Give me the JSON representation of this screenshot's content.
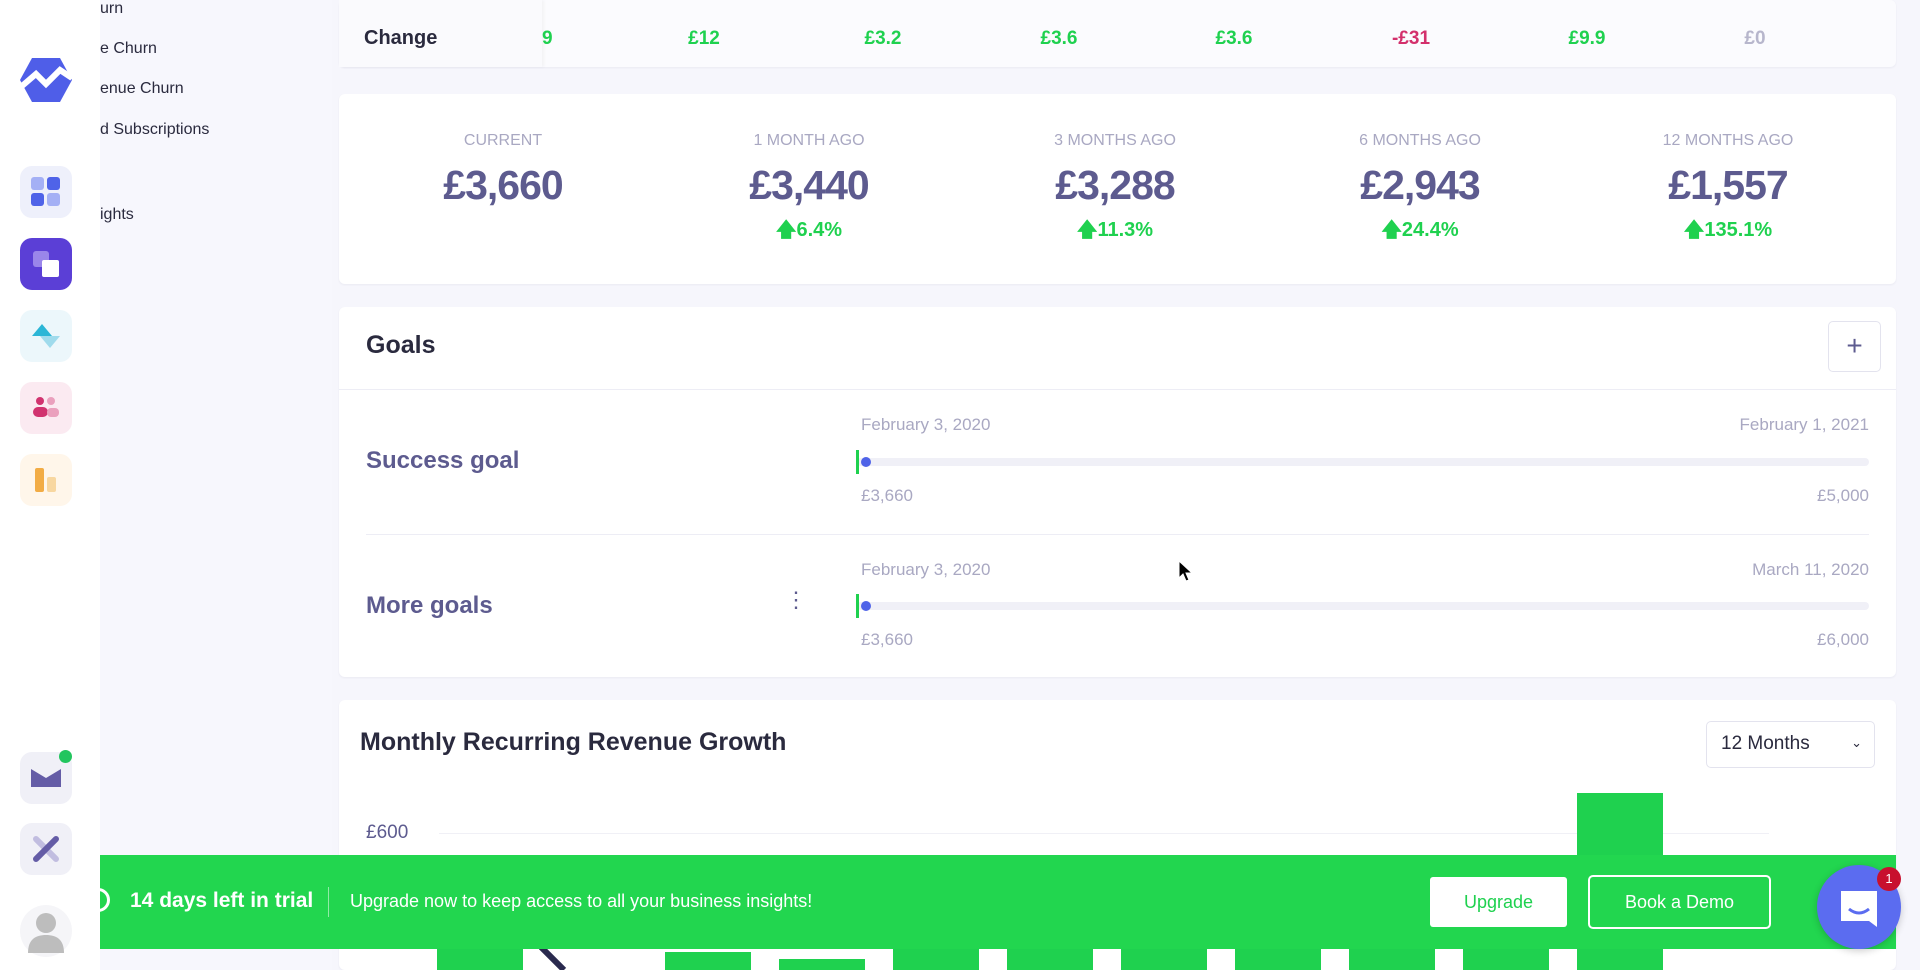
{
  "sidebar": {
    "icons": [
      "logo-icon",
      "dashboard-icon",
      "layers-icon",
      "insights-icon",
      "customers-icon",
      "reports-icon",
      "mail-icon",
      "tools-icon",
      "avatar-icon"
    ],
    "mail_badge_color": "#22c55e"
  },
  "submenu": {
    "items": [
      "urn",
      "e Churn",
      "enue Churn",
      "d Subscriptions",
      "ights"
    ]
  },
  "change_row": {
    "label": "Change",
    "values": [
      "9",
      "£12",
      "£3.2",
      "£3.6",
      "£3.6",
      "-£31",
      "£9.9",
      "£0"
    ]
  },
  "stats": [
    {
      "label": "CURRENT",
      "value": "£3,660",
      "change": ""
    },
    {
      "label": "1 MONTH AGO",
      "value": "£3,440",
      "change": "6.4%"
    },
    {
      "label": "3 MONTHS AGO",
      "value": "£3,288",
      "change": "11.3%"
    },
    {
      "label": "6 MONTHS AGO",
      "value": "£2,943",
      "change": "24.4%"
    },
    {
      "label": "12 MONTHS AGO",
      "value": "£1,557",
      "change": "135.1%"
    }
  ],
  "goals": {
    "title": "Goals",
    "add_label": "+",
    "items": [
      {
        "name": "Success goal",
        "start_date": "February 3, 2020",
        "end_date": "February 1, 2021",
        "current": "£3,660",
        "target": "£5,000",
        "progress": 0.01
      },
      {
        "name": "More goals",
        "start_date": "February 3, 2020",
        "end_date": "March 11, 2020",
        "current": "£3,660",
        "target": "£6,000",
        "progress": 0.01
      }
    ]
  },
  "mrr": {
    "title": "Monthly Recurring Revenue Growth",
    "range": "12 Months"
  },
  "chart_data": {
    "type": "bar",
    "y_tick_labels": [
      "£600"
    ],
    "values": [
      390,
      0,
      375,
      362,
      390,
      390,
      390,
      390,
      390,
      390,
      676
    ],
    "color": "#1fd14f"
  },
  "banner": {
    "trial": "14 days left in trial",
    "message": "Upgrade now to keep access to all your business insights!",
    "upgrade": "Upgrade",
    "demo": "Book a Demo",
    "color": "#22d64f"
  },
  "chat": {
    "badge": "1"
  }
}
